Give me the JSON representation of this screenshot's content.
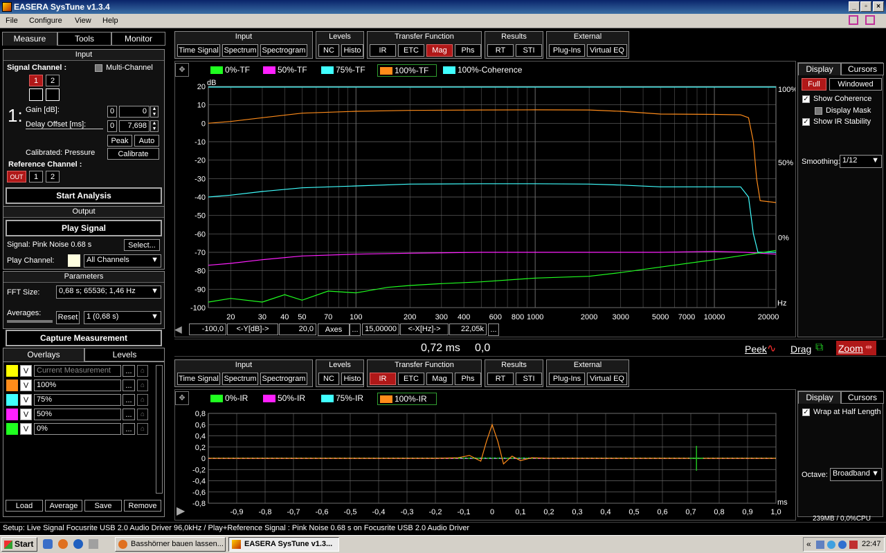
{
  "window": {
    "title": "EASERA SysTune v1.3.4"
  },
  "menu": [
    "File",
    "Configure",
    "View",
    "Help"
  ],
  "left_tabs": [
    "Measure",
    "Tools",
    "Monitor"
  ],
  "input": {
    "header": "Input",
    "signal_channel": "Signal Channel :",
    "multi_channel": "Multi-Channel",
    "ch1": "1",
    "ch2": "2",
    "big_index": "1:",
    "gain_label": "Gain [dB]:",
    "delay_label": "Delay Offset [ms]:",
    "gain_a": "0",
    "gain_b": "0",
    "delay_a": "0",
    "delay_b": "7,698",
    "peak": "Peak",
    "auto": "Auto",
    "calibrated": "Calibrated: Pressure",
    "calibrate": "Calibrate",
    "reference_channel": "Reference Channel :",
    "ref_out": "OUT",
    "ref1": "1",
    "ref2": "2"
  },
  "start_analysis": "Start Analysis",
  "output": {
    "header": "Output",
    "play_signal": "Play Signal",
    "signal": "Signal: Pink Noise  0.68 s",
    "select": "Select...",
    "play_channel": "Play Channel:",
    "all_channels": "All Channels"
  },
  "parameters": {
    "header": "Parameters",
    "fft_label": "FFT Size:",
    "fft_value": "0,68 s; 65536; 1,46 Hz",
    "averages": "Averages:",
    "reset": "Reset",
    "avg_value": "1 (0,68 s)"
  },
  "capture": "Capture Measurement",
  "overlay_tabs": [
    "Overlays",
    "Levels"
  ],
  "overlays": [
    {
      "color": "#ffff00",
      "v": "V",
      "name": "Current Measurement"
    },
    {
      "color": "#ff8c1a",
      "v": "V",
      "name": "100%"
    },
    {
      "color": "#40ffff",
      "v": "V",
      "name": "75%"
    },
    {
      "color": "#ff20ff",
      "v": "V",
      "name": "50%"
    },
    {
      "color": "#20ff20",
      "v": "V",
      "name": "0%"
    }
  ],
  "overlay_dots": "...",
  "overlay_buttons": [
    "Load",
    "Average",
    "Save",
    "Remove"
  ],
  "toolbar": {
    "groups": [
      {
        "title": "Input",
        "buttons": [
          "Time Signal",
          "Spectrum",
          "Spectrogram"
        ]
      },
      {
        "title": "Levels",
        "buttons": [
          "NC",
          "Histo"
        ]
      },
      {
        "title": "Transfer Function",
        "buttons": [
          "IR",
          "ETC",
          "Mag",
          "Phs"
        ]
      },
      {
        "title": "Results",
        "buttons": [
          "RT",
          "STI"
        ]
      },
      {
        "title": "External",
        "buttons": [
          "Plug-Ins",
          "Virtual EQ"
        ]
      }
    ],
    "top_selected": "Mag",
    "bottom_selected": "IR"
  },
  "top_legend": [
    {
      "label": "0%-TF",
      "color": "#20ff20"
    },
    {
      "label": "50%-TF",
      "color": "#ff20ff"
    },
    {
      "label": "75%-TF",
      "color": "#40ffff"
    },
    {
      "label": "100%-TF",
      "color": "#ff8c1a"
    },
    {
      "label": "100%-Coherence",
      "color": "#40ffff"
    }
  ],
  "bottom_legend": [
    {
      "label": "0%-IR",
      "color": "#20ff20"
    },
    {
      "label": "50%-IR",
      "color": "#ff20ff"
    },
    {
      "label": "75%-IR",
      "color": "#40ffff"
    },
    {
      "label": "100%-IR",
      "color": "#ff8c1a"
    }
  ],
  "chart_data": [
    {
      "type": "line",
      "ylabel": "dB",
      "xlabel": "Hz",
      "xscale": "log",
      "xlim": [
        15,
        22050
      ],
      "ylim": [
        -100,
        20
      ],
      "yticks": [
        "20",
        "10",
        "0",
        "-10",
        "-20",
        "-30",
        "-40",
        "-50",
        "-60",
        "-70",
        "-80",
        "-90",
        "-100"
      ],
      "xticks": [
        "20",
        "30",
        "40",
        "50",
        "70",
        "100",
        "200",
        "300",
        "400",
        "600",
        "800",
        "1000",
        "2000",
        "3000",
        "5000",
        "7000",
        "10000",
        "20000"
      ],
      "coherence_ticks": [
        "100%",
        "50%",
        "0%"
      ],
      "series": [
        {
          "name": "100%-TF",
          "x": [
            15,
            20,
            30,
            50,
            100,
            200,
            500,
            1000,
            2000,
            3000,
            5000,
            10000,
            14000,
            15500,
            16500,
            17200,
            18000,
            22050
          ],
          "y": [
            0,
            1,
            3,
            5.5,
            6.5,
            7,
            7.2,
            7.3,
            7.2,
            6.5,
            5,
            4.8,
            4.6,
            3,
            -10,
            -30,
            -42,
            -43
          ]
        },
        {
          "name": "75%-TF",
          "x": [
            15,
            20,
            30,
            50,
            100,
            200,
            500,
            1000,
            2000,
            3000,
            5000,
            10000,
            14000,
            15500,
            16500,
            17500,
            22050
          ],
          "y": [
            -40,
            -39,
            -37,
            -35,
            -34,
            -33,
            -32.8,
            -32.8,
            -33,
            -33.5,
            -34.5,
            -34.5,
            -34.5,
            -40,
            -60,
            -70,
            -70
          ]
        },
        {
          "name": "50%-TF",
          "x": [
            15,
            20,
            30,
            50,
            100,
            200,
            500,
            1000,
            2000,
            5000,
            10000,
            15000,
            22050
          ],
          "y": [
            -77,
            -76,
            -74,
            -72,
            -71,
            -70.5,
            -70,
            -70,
            -70,
            -70,
            -69.5,
            -70,
            -71
          ]
        },
        {
          "name": "0%-TF",
          "x": [
            15,
            20,
            30,
            40,
            50,
            70,
            100,
            150,
            200,
            300,
            500,
            1000,
            2000,
            3000,
            5000,
            10000,
            22050
          ],
          "y": [
            -97,
            -95,
            -97,
            -93,
            -96,
            -91,
            -92,
            -89,
            -88,
            -87,
            -86,
            -84,
            -83,
            -81,
            -78,
            -74,
            -69
          ]
        }
      ]
    },
    {
      "type": "line",
      "xlabel": "ms",
      "xlim": [
        -1,
        1
      ],
      "ylim": [
        -0.8,
        0.8
      ],
      "yticks": [
        "0,8",
        "0,6",
        "0,4",
        "0,2",
        "0",
        "-0,2",
        "-0,4",
        "-0,6",
        "-0,8"
      ],
      "xticks": [
        "-0,9",
        "-0,8",
        "-0,7",
        "-0,6",
        "-0,5",
        "-0,4",
        "-0,3",
        "-0,2",
        "-0,1",
        "0",
        "0,1",
        "0,2",
        "0,3",
        "0,4",
        "0,5",
        "0,6",
        "0,7",
        "0,8",
        "0,9",
        "1,0"
      ],
      "series": [
        {
          "name": "100%-IR",
          "x": [
            -1,
            -0.2,
            -0.12,
            -0.08,
            -0.04,
            -0.02,
            0,
            0.02,
            0.04,
            0.07,
            0.1,
            0.14,
            0.2,
            1
          ],
          "y": [
            0,
            0,
            0.01,
            0.05,
            -0.05,
            0.3,
            0.6,
            0.3,
            -0.1,
            0.04,
            -0.04,
            0.01,
            0,
            0
          ]
        }
      ]
    }
  ],
  "axis_bar": {
    "a": "-100,0",
    "b": "<-Y[dB]->",
    "c": "20,0",
    "axes": "Axes",
    "d": "...",
    "e": "15,00000",
    "f": "<-X[Hz]->",
    "g": "22,05k",
    "h": "..."
  },
  "readout": {
    "time": "0,72 ms",
    "value": "0,0",
    "peek": "Peek",
    "drag": "Drag",
    "zoom": "Zoom"
  },
  "top_side": {
    "tabs": [
      "Display",
      "Cursors"
    ],
    "full": "Full",
    "windowed": "Windowed",
    "show_coherence": "Show Coherence",
    "display_mask": "Display Mask",
    "show_ir": "Show IR Stability",
    "smoothing_label": "Smoothing:",
    "smoothing": "1/12"
  },
  "bottom_side": {
    "tabs": [
      "Display",
      "Cursors"
    ],
    "wrap": "Wrap at Half Length",
    "octave_label": "Octave:",
    "octave": "Broadband",
    "memory": "239MB / 0,0%CPU"
  },
  "status": "Setup: Live Signal Focusrite USB 2.0 Audio Driver 96,0kHz / Play+Reference Signal : Pink Noise  0.68 s on Focusrite USB 2.0 Audio Driver",
  "taskbar": {
    "start": "Start",
    "task1": "Basshörner bauen lassen...",
    "task2": "EASERA SysTune v1.3...",
    "clock": "22:47"
  }
}
